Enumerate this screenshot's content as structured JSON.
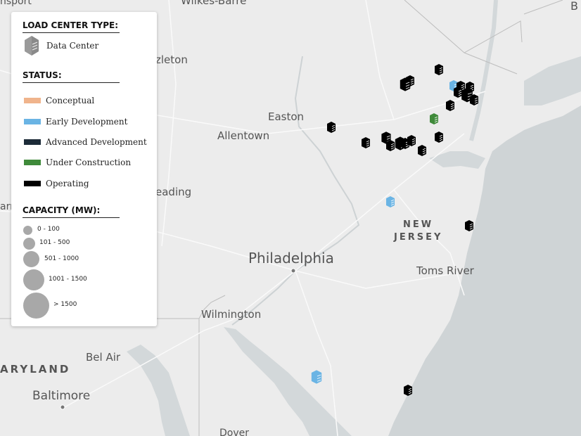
{
  "map": {
    "places": [
      {
        "name": "Wilkes-Barre"
      },
      {
        "name": "nsport"
      },
      {
        "name": "zleton"
      },
      {
        "name": "Easton"
      },
      {
        "name": "Allentown"
      },
      {
        "name": "eading"
      },
      {
        "name": "arr"
      },
      {
        "name": "NEW"
      },
      {
        "name": "JERSEY"
      },
      {
        "name": "Philadelphia"
      },
      {
        "name": "Toms River"
      },
      {
        "name": "Wilmington"
      },
      {
        "name": "Bel Air"
      },
      {
        "name": "ARYLAND"
      },
      {
        "name": "Baltimore"
      },
      {
        "name": "Dover"
      },
      {
        "name": "B"
      }
    ],
    "markers_count": 24
  },
  "legend": {
    "type_title": "LOAD CENTER TYPE:",
    "type_label": "Data Center",
    "status_title": "STATUS:",
    "statuses": [
      {
        "label": "Conceptual",
        "color": "#f0b48c"
      },
      {
        "label": "Early Development",
        "color": "#6ab4e4"
      },
      {
        "label": "Advanced Development",
        "color": "#1c2b38"
      },
      {
        "label": "Under Construction",
        "color": "#3f8a3a"
      },
      {
        "label": "Operating",
        "color": "#000000"
      }
    ],
    "capacity_title": "CAPACITY (MW):",
    "capacities": [
      {
        "label": "0 - 100"
      },
      {
        "label": "101 - 500"
      },
      {
        "label": "501 - 1000"
      },
      {
        "label": "1001 - 1500"
      },
      {
        "label": "> 1500"
      }
    ]
  }
}
